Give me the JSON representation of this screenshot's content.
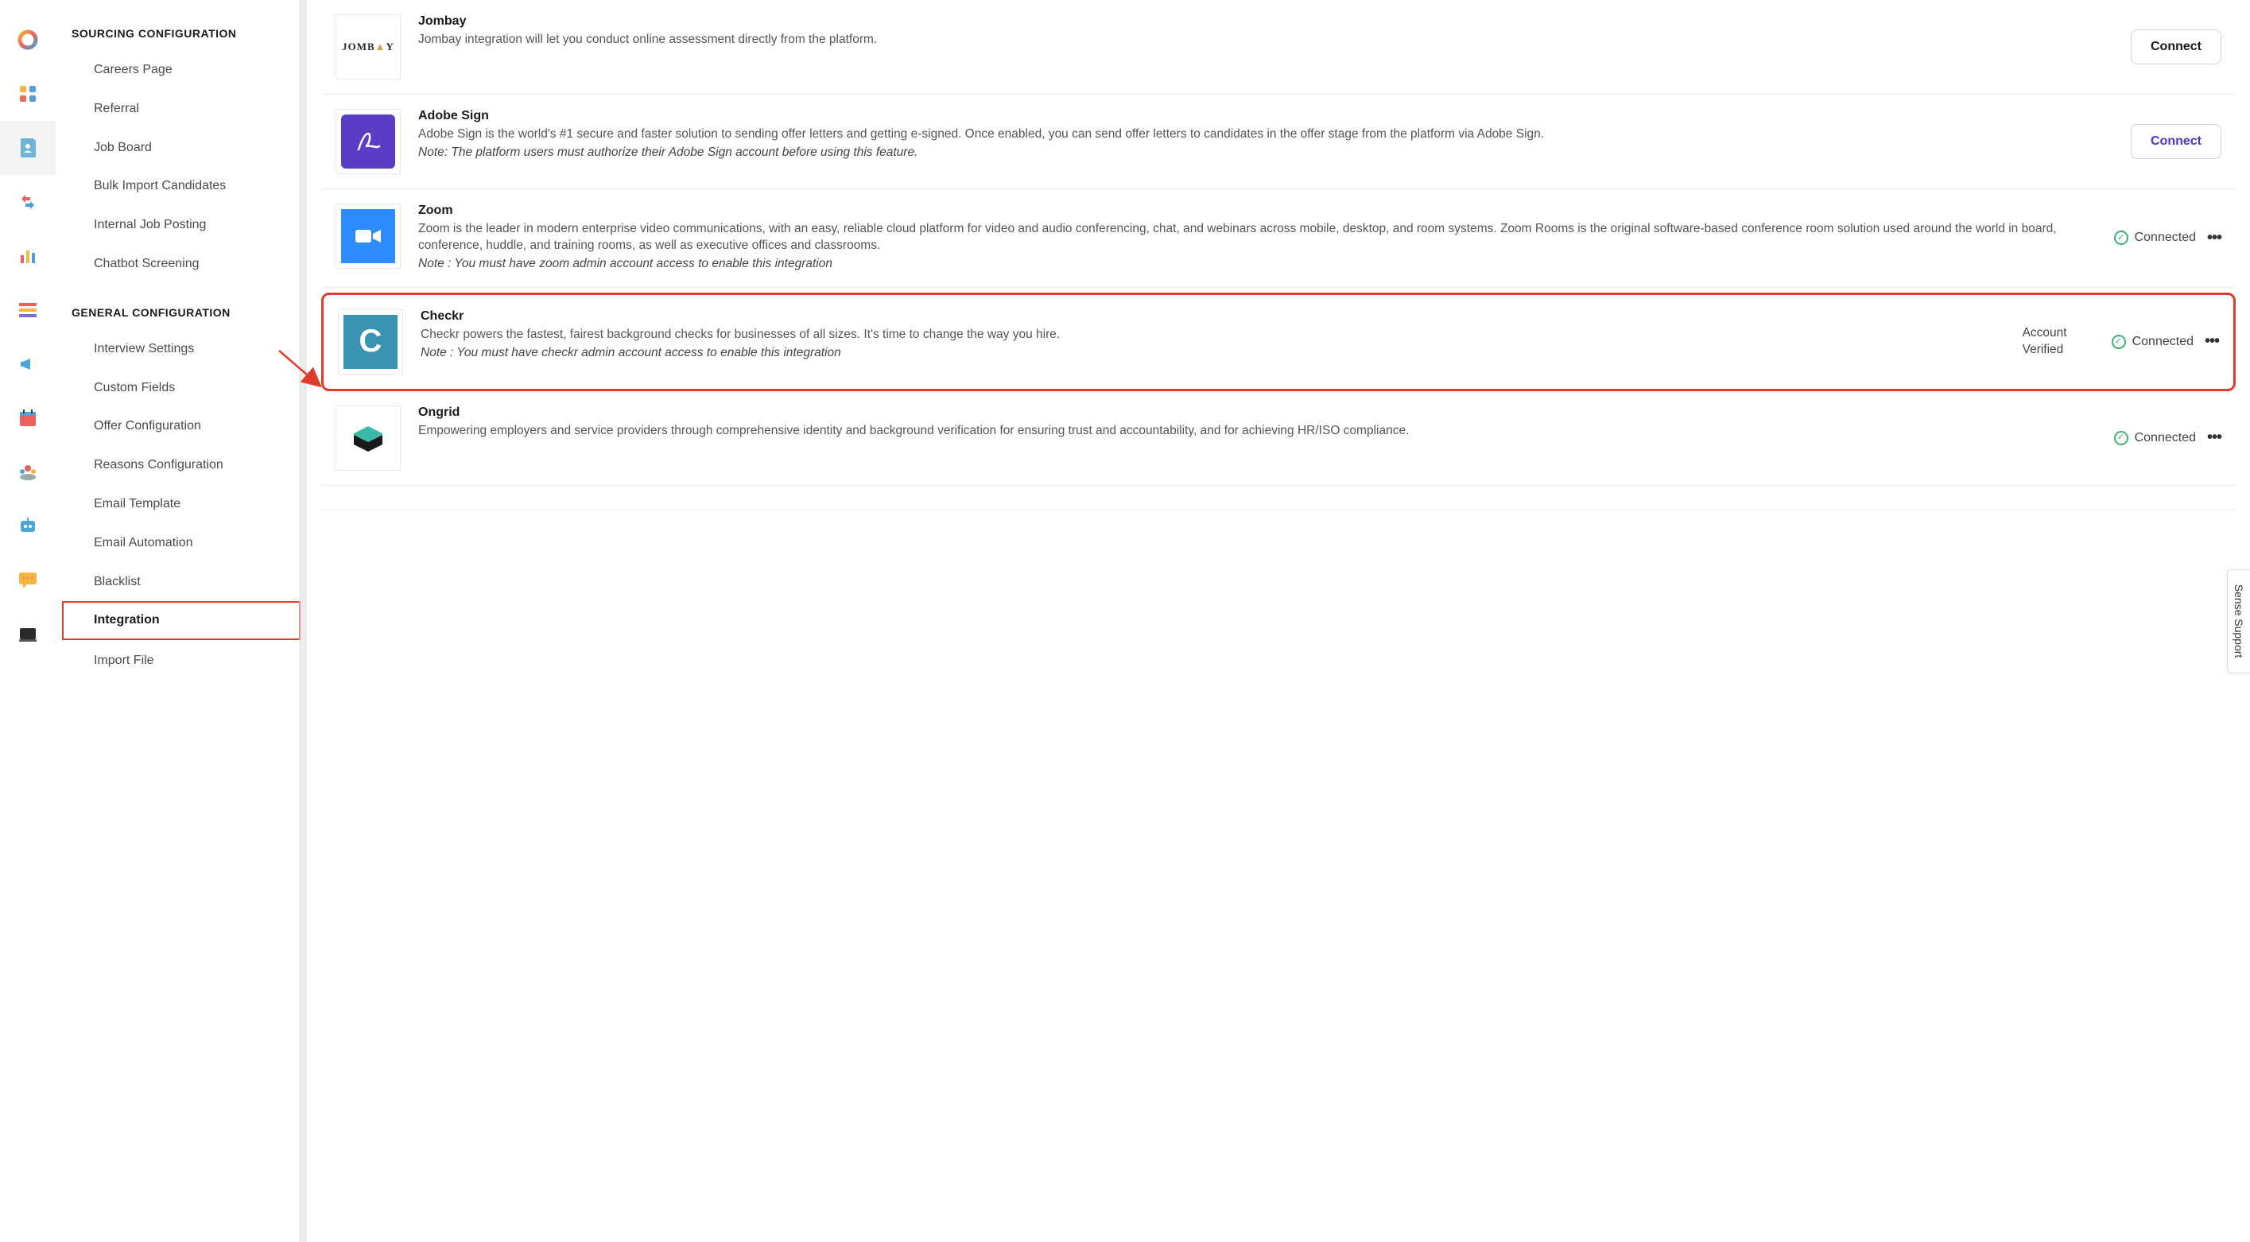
{
  "sidebar": {
    "sections": [
      {
        "title": "SOURCING CONFIGURATION",
        "items": [
          {
            "label": "Careers Page"
          },
          {
            "label": "Referral"
          },
          {
            "label": "Job Board"
          },
          {
            "label": "Bulk Import Candidates"
          },
          {
            "label": "Internal Job Posting"
          },
          {
            "label": "Chatbot Screening"
          }
        ]
      },
      {
        "title": "GENERAL CONFIGURATION",
        "items": [
          {
            "label": "Interview Settings"
          },
          {
            "label": "Custom Fields"
          },
          {
            "label": "Offer Configuration"
          },
          {
            "label": "Reasons Configuration"
          },
          {
            "label": "Email Template"
          },
          {
            "label": "Email Automation"
          },
          {
            "label": "Blacklist"
          },
          {
            "label": "Integration",
            "highlighted": true
          },
          {
            "label": "Import File"
          }
        ]
      }
    ]
  },
  "integrations": [
    {
      "name": "Jombay",
      "logo_text": "JOMBAY",
      "description": "Jombay integration will let you conduct online assessment directly from the platform.",
      "action": {
        "type": "connect_button",
        "label": "Connect",
        "variant": "dark"
      }
    },
    {
      "name": "Adobe Sign",
      "logo_text": "AdobeSign",
      "description": "Adobe Sign is the world's #1 secure and faster solution to sending offer letters and getting e-signed. Once enabled, you can send offer letters to candidates in the offer stage from the platform via Adobe Sign.",
      "note": "Note: The platform users must authorize their Adobe Sign account before using this feature.",
      "action": {
        "type": "connect_button",
        "label": "Connect",
        "variant": "accent"
      }
    },
    {
      "name": "Zoom",
      "logo_text": "Zoom",
      "description": "Zoom is the leader in modern enterprise video communications, with an easy, reliable cloud platform for video and audio conferencing, chat, and webinars across mobile, desktop, and room systems. Zoom Rooms is the original software-based conference room solution used around the world in board, conference, huddle, and training rooms, as well as executive offices and classrooms.",
      "note": "Note : You must have zoom admin account access to enable this integration",
      "action": {
        "type": "connected",
        "label": "Connected"
      }
    },
    {
      "name": "Checkr",
      "logo_text": "C",
      "description": "Checkr powers the fastest, fairest background checks for businesses of all sizes. It's time to change the way you hire.",
      "note": "Note : You must have checkr admin account access to enable this integration",
      "extra_status": "Account Verified",
      "action": {
        "type": "connected",
        "label": "Connected"
      },
      "highlighted": true
    },
    {
      "name": "Ongrid",
      "logo_text": "Ongrid",
      "description": "Empowering employers and service providers through comprehensive identity and background verification for ensuring trust and accountability, and for achieving HR/ISO compliance.",
      "action": {
        "type": "connected",
        "label": "Connected"
      }
    }
  ],
  "support_label": "Sense Support"
}
